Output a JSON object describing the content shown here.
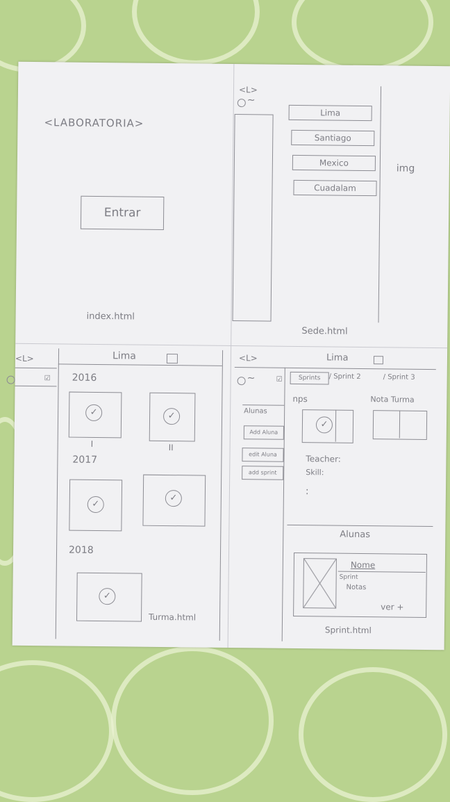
{
  "index": {
    "logo": "<LABORATORIA>",
    "enter_button": "Entrar",
    "filename": "index.html"
  },
  "sede": {
    "logo": "<L>",
    "menu_mark": "~",
    "cities": [
      "Lima",
      "Santiago",
      "Mexico",
      "Cuadalam"
    ],
    "img_label": "img",
    "filename": "Sede.html"
  },
  "turma": {
    "logo": "<L>",
    "title": "Lima",
    "year_2016": "2016",
    "year_2017": "2017",
    "year_2018": "2018",
    "turma_mark_1": "I",
    "turma_mark_2": "II",
    "filename": "Turma.html"
  },
  "sprint": {
    "logo": "<L>",
    "menu_mark": "~",
    "title": "Lima",
    "tab_1": "Sprints",
    "tab_2": "/ Sprint 2",
    "tab_3": "/ Sprint 3",
    "sidebar_items": [
      "Alunas",
      "Add Aluna",
      "edit Aluna",
      "add sprint"
    ],
    "nps_label": "nps",
    "nota_label": "Nota Turma",
    "teacher_label": "Teacher:",
    "skill_label": "Skill:",
    "ellipsis": ":",
    "alunas_label": "Alunas",
    "card_name": "Nome",
    "card_sprint": "Sprint",
    "card_notes": "Notas",
    "card_link": "ver +",
    "filename": "Sprint.html"
  },
  "colors": {
    "tablecloth": "#b9d38f",
    "paper": "#f1f1f3",
    "pencil": "#7d7d84"
  }
}
